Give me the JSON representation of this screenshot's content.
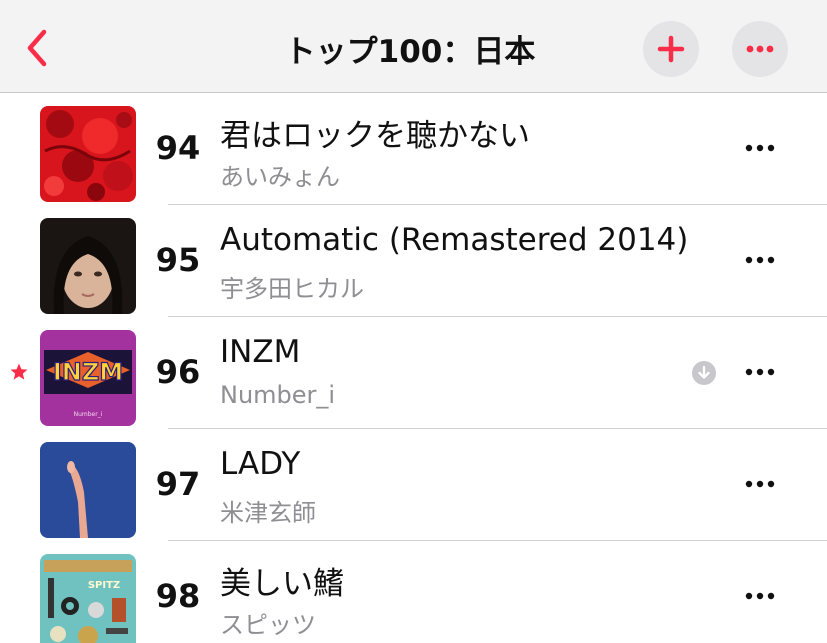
{
  "nav": {
    "title": "トップ100：日本",
    "back_icon": "chevron-left-icon",
    "add_icon": "plus-icon",
    "more_icon": "ellipsis-icon",
    "accent_color": "#fa2d48"
  },
  "tracks": [
    {
      "rank": "94",
      "title": "君はロックを聴かない",
      "artist": "あいみょん",
      "artwork": "red-abstract-artwork",
      "downloaded": false,
      "favorite": false
    },
    {
      "rank": "95",
      "title": "Automatic (Remastered 2014)",
      "artist": "宇多田ヒカル",
      "artwork": "portrait-artwork",
      "downloaded": false,
      "favorite": false
    },
    {
      "rank": "96",
      "title": "INZM",
      "artist": "Number_i",
      "artwork": "inzm-logo-artwork",
      "downloaded": true,
      "favorite": true
    },
    {
      "rank": "97",
      "title": "LADY",
      "artist": "米津玄師",
      "artwork": "blue-arm-artwork",
      "downloaded": false,
      "favorite": false
    },
    {
      "rank": "98",
      "title": "美しい鰭",
      "artist": "スピッツ",
      "artwork": "spitz-items-artwork",
      "downloaded": false,
      "favorite": false
    }
  ],
  "artwork_text": {
    "inzm_logo": "INZM",
    "inzm_artist": "Number_i",
    "spitz_logo": "SPITZ"
  }
}
